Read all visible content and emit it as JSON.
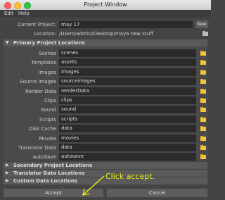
{
  "window": {
    "title": "Project Window"
  },
  "menubar": {
    "items": [
      "Edit",
      "Help"
    ]
  },
  "project": {
    "current_label": "Current Project:",
    "current_value": "may 17",
    "new_label": "New",
    "location_label": "Location:",
    "location_value": "/Users/admin/Desktop/maya new stuff"
  },
  "primary": {
    "title": "Primary Project Locations",
    "rows": [
      {
        "label": "Scenes",
        "value": "scenes"
      },
      {
        "label": "Templates",
        "value": "assets"
      },
      {
        "label": "Images",
        "value": "images"
      },
      {
        "label": "Source Images",
        "value": "sourceimages"
      },
      {
        "label": "Render Data",
        "value": "renderData"
      },
      {
        "label": "Clips",
        "value": "clips"
      },
      {
        "label": "Sound",
        "value": "sound"
      },
      {
        "label": "Scripts",
        "value": "scripts"
      },
      {
        "label": "Disk Cache",
        "value": "data"
      },
      {
        "label": "Movies",
        "value": "movies"
      },
      {
        "label": "Translator Data",
        "value": "data"
      },
      {
        "label": "AutoSave",
        "value": "autosave"
      }
    ]
  },
  "collapsed_sections": [
    "Secondary Project Locations",
    "Translator Data Locations",
    "Custom Data Locations"
  ],
  "buttons": {
    "accept": "Accept",
    "cancel": "Cancel"
  },
  "annotation": {
    "text": "Click accept.",
    "color": "#f2f21d"
  }
}
